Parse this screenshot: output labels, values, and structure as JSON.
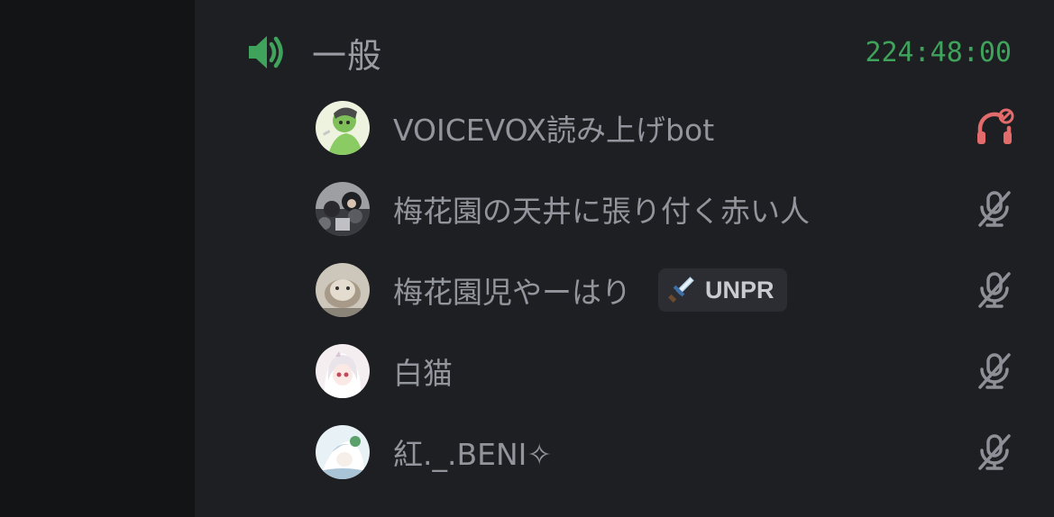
{
  "channel": {
    "name": "一般",
    "timer": "224:48:00",
    "icon": "speaker-icon",
    "accent_color": "#3fa35c"
  },
  "members": [
    {
      "name": "VOICEVOX読み上げbot",
      "status_icon": "deafened-headphones-icon",
      "status_color": "#e26b6b"
    },
    {
      "name": "梅花園の天井に張り付く赤い人",
      "status_icon": "muted-microphone-icon",
      "status_color": "#8e9097"
    },
    {
      "name": "梅花園児やーはり",
      "tag": {
        "icon": "sword-icon",
        "label": "UNPR"
      },
      "status_icon": "muted-microphone-icon",
      "status_color": "#8e9097"
    },
    {
      "name": "白猫",
      "status_icon": "muted-microphone-icon",
      "status_color": "#8e9097"
    },
    {
      "name": "紅._.BENI✧",
      "status_icon": "muted-microphone-icon",
      "status_color": "#8e9097"
    }
  ]
}
